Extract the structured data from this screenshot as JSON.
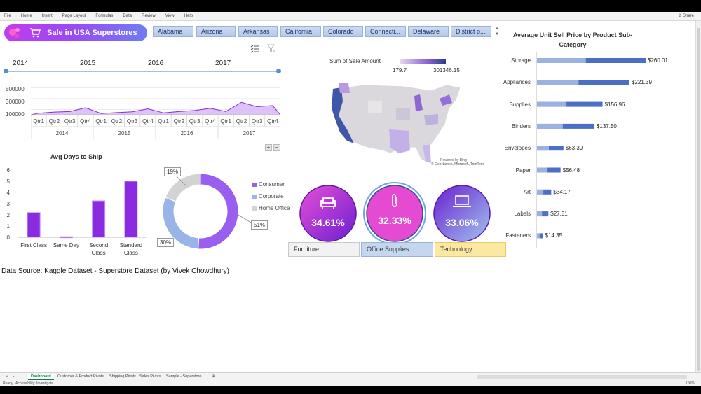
{
  "ribbon": {
    "tabs": [
      "File",
      "Home",
      "Insert",
      "Page Layout",
      "Formulas",
      "Data",
      "Review",
      "View",
      "Help"
    ],
    "share_label": "Share"
  },
  "header": {
    "title": "Sale in USA Superstores"
  },
  "state_slicer": {
    "items": [
      "Alabama",
      "Arizona",
      "Arkansas",
      "California",
      "Colorado",
      "Connecti...",
      "Delaware",
      "District o..."
    ]
  },
  "timeline": {
    "years": [
      "2014",
      "2015",
      "2016",
      "2017"
    ]
  },
  "sales_trend": {
    "y_ticks": [
      "500000",
      "300000",
      "100000"
    ],
    "quarters": [
      "Qtr1",
      "Qtr2",
      "Qtr3",
      "Qtr4",
      "Qtr1",
      "Qtr2",
      "Qtr3",
      "Qtr4",
      "Qtr1",
      "Qtr2",
      "Qtr3",
      "Qtr4",
      "Qtr1",
      "Qtr2",
      "Qtr3",
      "Qtr4"
    ],
    "years": [
      "2014",
      "2015",
      "2016",
      "2017"
    ],
    "zoom_plus": "+",
    "zoom_minus": "−"
  },
  "chart_data": [
    {
      "type": "area",
      "x": [
        "2014 Qtr1",
        "2014 Qtr2",
        "2014 Qtr3",
        "2014 Qtr4",
        "2015 Qtr1",
        "2015 Qtr2",
        "2015 Qtr3",
        "2015 Qtr4",
        "2016 Qtr1",
        "2016 Qtr2",
        "2016 Qtr3",
        "2016 Qtr4",
        "2017 Qtr1",
        "2017 Qtr2",
        "2017 Qtr3",
        "2017 Qtr4"
      ],
      "values": [
        30000,
        50000,
        60000,
        130000,
        25000,
        40000,
        55000,
        110000,
        35000,
        60000,
        80000,
        120000,
        60000,
        230000,
        150000,
        170000
      ],
      "ylim": [
        0,
        600000
      ],
      "title": "",
      "xlabel": "",
      "ylabel": ""
    },
    {
      "type": "bar",
      "title": "Avg Days to Ship",
      "categories": [
        "First Class",
        "Same Day",
        "Second Class",
        "Standard Class"
      ],
      "values": [
        2.2,
        0.05,
        3.25,
        5.0
      ],
      "y_ticks": [
        "6",
        "5",
        "4",
        "3",
        "2",
        "1",
        "0"
      ],
      "ylim": [
        0,
        6
      ]
    },
    {
      "type": "pie",
      "labels": [
        "Consumer",
        "Corporate",
        "Home Office"
      ],
      "values": [
        51,
        30,
        19
      ],
      "value_labels": [
        "51%",
        "30%",
        "19%"
      ],
      "colors": [
        "#9b5ff0",
        "#99b4e6",
        "#d3d3d3"
      ]
    },
    {
      "type": "bar",
      "title": "Average Unit Sell Price by Product Sub-Category",
      "orientation": "horizontal",
      "categories": [
        "Storage",
        "Appliances",
        "Supplies",
        "Binders",
        "Envelopes",
        "Paper",
        "Art",
        "Labels",
        "Fasteners"
      ],
      "values": [
        260.01,
        221.39,
        156.96,
        137.5,
        63.39,
        56.48,
        34.17,
        27.31,
        14.35
      ],
      "value_labels": [
        "$260.01",
        "$221.39",
        "$156.96",
        "$137.50",
        "$63.39",
        "$56.48",
        "$34.17",
        "$27.31",
        "$14.35"
      ]
    }
  ],
  "map": {
    "legend_title": "Sum of Sale Amount",
    "min": "179.7",
    "max": "301346.15",
    "credit1": "Powered by Bing",
    "credit2": "© GeoNames, Microsoft, TomTom"
  },
  "categories": [
    {
      "icon": "sofa-icon",
      "pct": "34.61%",
      "slicer": "Furniture"
    },
    {
      "icon": "paperclip-icon",
      "pct": "32.33%",
      "slicer": "Office Supplies"
    },
    {
      "icon": "laptop-icon",
      "pct": "33.06%",
      "slicer": "Technology"
    }
  ],
  "source_note": "Data Source: Kaggle Dataset - Superstore Dataset (by Vivek Chowdhury)",
  "sheet_tabs": [
    "Dashboard",
    "Customer & Product Pivots",
    "Shipping Pivots",
    "Sales Pivots",
    "Sample - Superstore"
  ],
  "status": {
    "ready": "Ready",
    "accessibility": "Accessibility: Investigate",
    "zoom": "100%"
  },
  "colors": {
    "purple": "#8a2be2",
    "blue_bar": "#4a6fc4",
    "excel_green": "#107c41"
  }
}
